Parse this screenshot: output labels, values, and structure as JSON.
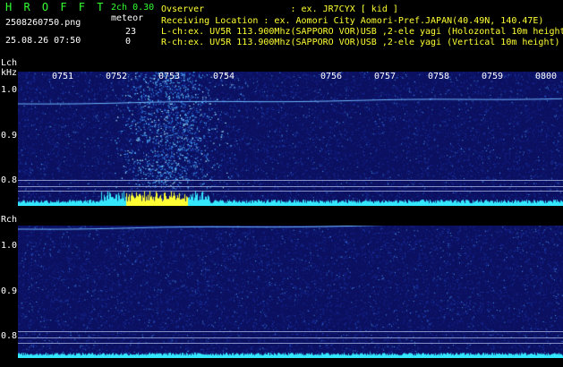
{
  "header": {
    "app_title": "H R O F F T",
    "filename": "2508260750.png",
    "datetime": "25.08.26 07:50",
    "params": {
      "channels": "2ch 0.30",
      "mode": "meteor",
      "count_l": "23",
      "count_r": "0"
    },
    "observer": "Ovserver                : ex. JR7CYX [ kid ]",
    "location": "Receiving Location : ex. Aomori City Aomori-Pref.JAPAN(40.49N, 140.47E)",
    "lch_info": "L-ch:ex. UV5R 113.900Mhz(SAPPORO VOR)USB ,2-ele yagi (Holozontal 10m height)",
    "rch_info": "R-ch:ex. UV5R 113.900Mhz(SAPPORO VOR)USB ,2-ele yagi (Vertical 10m height)"
  },
  "lch_panel": {
    "label": "Lch",
    "unit": "kHz",
    "y_labels": [
      "1.0",
      "0.9",
      "0.8"
    ]
  },
  "rch_panel": {
    "label": "Rch",
    "y_labels": [
      "1.0",
      "0.9",
      "0.8"
    ]
  },
  "time_ticks": [
    "0751",
    "0752",
    "0753",
    "0754",
    "0756",
    "0757",
    "0758",
    "0759",
    "0800"
  ],
  "colors": {
    "header_green": "#33ff33",
    "header_white": "#ffffff",
    "waterfall_bg": "#0c1270",
    "signal_level": "#33e8ff",
    "meteor_burst": "#ffff33"
  }
}
